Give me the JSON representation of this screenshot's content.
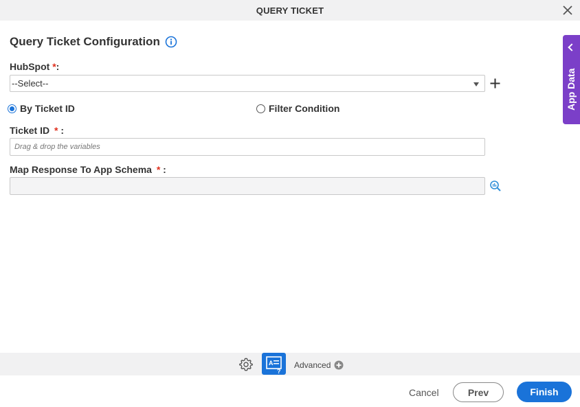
{
  "window": {
    "title": "QUERY TICKET"
  },
  "heading": "Query Ticket Configuration",
  "hubspot": {
    "label": "HubSpot",
    "required_mark": "*",
    "suffix": ":",
    "selected": "--Select--"
  },
  "radios": [
    {
      "label": "By Ticket ID",
      "checked": true
    },
    {
      "label": "Filter Condition",
      "checked": false
    }
  ],
  "ticket_id": {
    "label": "Ticket ID",
    "required_mark": "*",
    "suffix": ":",
    "placeholder": "Drag & drop the variables"
  },
  "map_response": {
    "label": "Map Response To App Schema",
    "required_mark": "*",
    "suffix": ":"
  },
  "app_data": {
    "label": "App Data"
  },
  "footer": {
    "advanced": "Advanced"
  },
  "buttons": {
    "cancel": "Cancel",
    "prev": "Prev",
    "finish": "Finish"
  },
  "colors": {
    "accent": "#1a73d9",
    "app_data_tab": "#7b3fc8",
    "required": "#e0301e"
  }
}
